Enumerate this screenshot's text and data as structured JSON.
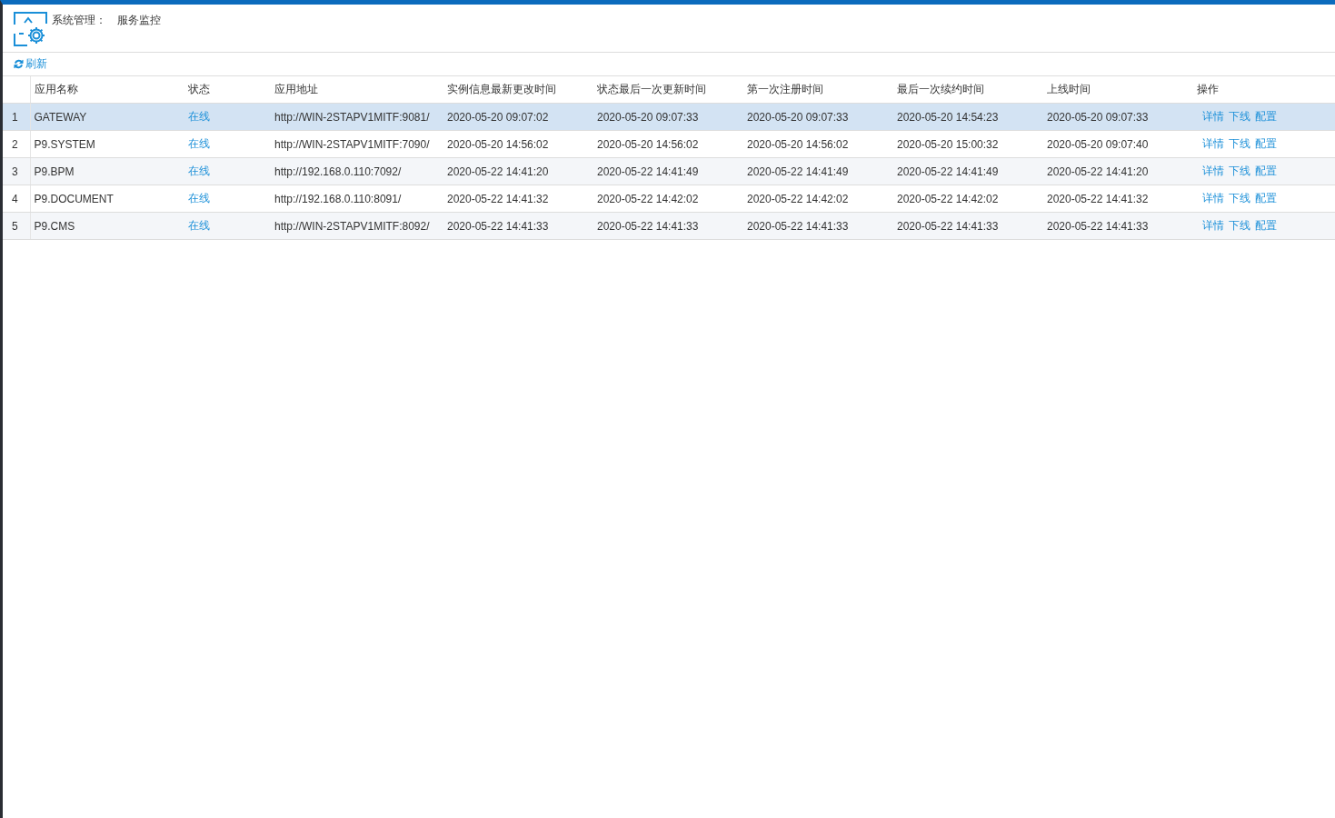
{
  "header": {
    "title": "系统管理：",
    "subtitle": "服务监控"
  },
  "toolbar": {
    "refresh": "刷新"
  },
  "table": {
    "columns": [
      "应用名称",
      "状态",
      "应用地址",
      "实例信息最新更改时间",
      "状态最后一次更新时间",
      "第一次注册时间",
      "最后一次续约时间",
      "上线时间",
      "操作"
    ],
    "rows": [
      {
        "index": "1",
        "selected": true,
        "cells": [
          "GATEWAY",
          "在线",
          "http://WIN-2STAPV1MITF:9081/",
          "2020-05-20 09:07:02",
          "2020-05-20 09:07:33",
          "2020-05-20 09:07:33",
          "2020-05-20 14:54:23",
          "2020-05-20 09:07:33"
        ],
        "actions": [
          "详情",
          "下线",
          "配置"
        ]
      },
      {
        "index": "2",
        "selected": false,
        "cells": [
          "P9.SYSTEM",
          "在线",
          "http://WIN-2STAPV1MITF:7090/",
          "2020-05-20 14:56:02",
          "2020-05-20 14:56:02",
          "2020-05-20 14:56:02",
          "2020-05-20 15:00:32",
          "2020-05-20 09:07:40"
        ],
        "actions": [
          "详情",
          "下线",
          "配置"
        ]
      },
      {
        "index": "3",
        "selected": false,
        "cells": [
          "P9.BPM",
          "在线",
          "http://192.168.0.110:7092/",
          "2020-05-22 14:41:20",
          "2020-05-22 14:41:49",
          "2020-05-22 14:41:49",
          "2020-05-22 14:41:49",
          "2020-05-22 14:41:20"
        ],
        "actions": [
          "详情",
          "下线",
          "配置"
        ]
      },
      {
        "index": "4",
        "selected": false,
        "cells": [
          "P9.DOCUMENT",
          "在线",
          "http://192.168.0.110:8091/",
          "2020-05-22 14:41:32",
          "2020-05-22 14:42:02",
          "2020-05-22 14:42:02",
          "2020-05-22 14:42:02",
          "2020-05-22 14:41:32"
        ],
        "actions": [
          "详情",
          "下线",
          "配置"
        ]
      },
      {
        "index": "5",
        "selected": false,
        "cells": [
          "P9.CMS",
          "在线",
          "http://WIN-2STAPV1MITF:8092/",
          "2020-05-22 14:41:33",
          "2020-05-22 14:41:33",
          "2020-05-22 14:41:33",
          "2020-05-22 14:41:33",
          "2020-05-22 14:41:33"
        ],
        "actions": [
          "详情",
          "下线",
          "配置"
        ]
      }
    ]
  }
}
